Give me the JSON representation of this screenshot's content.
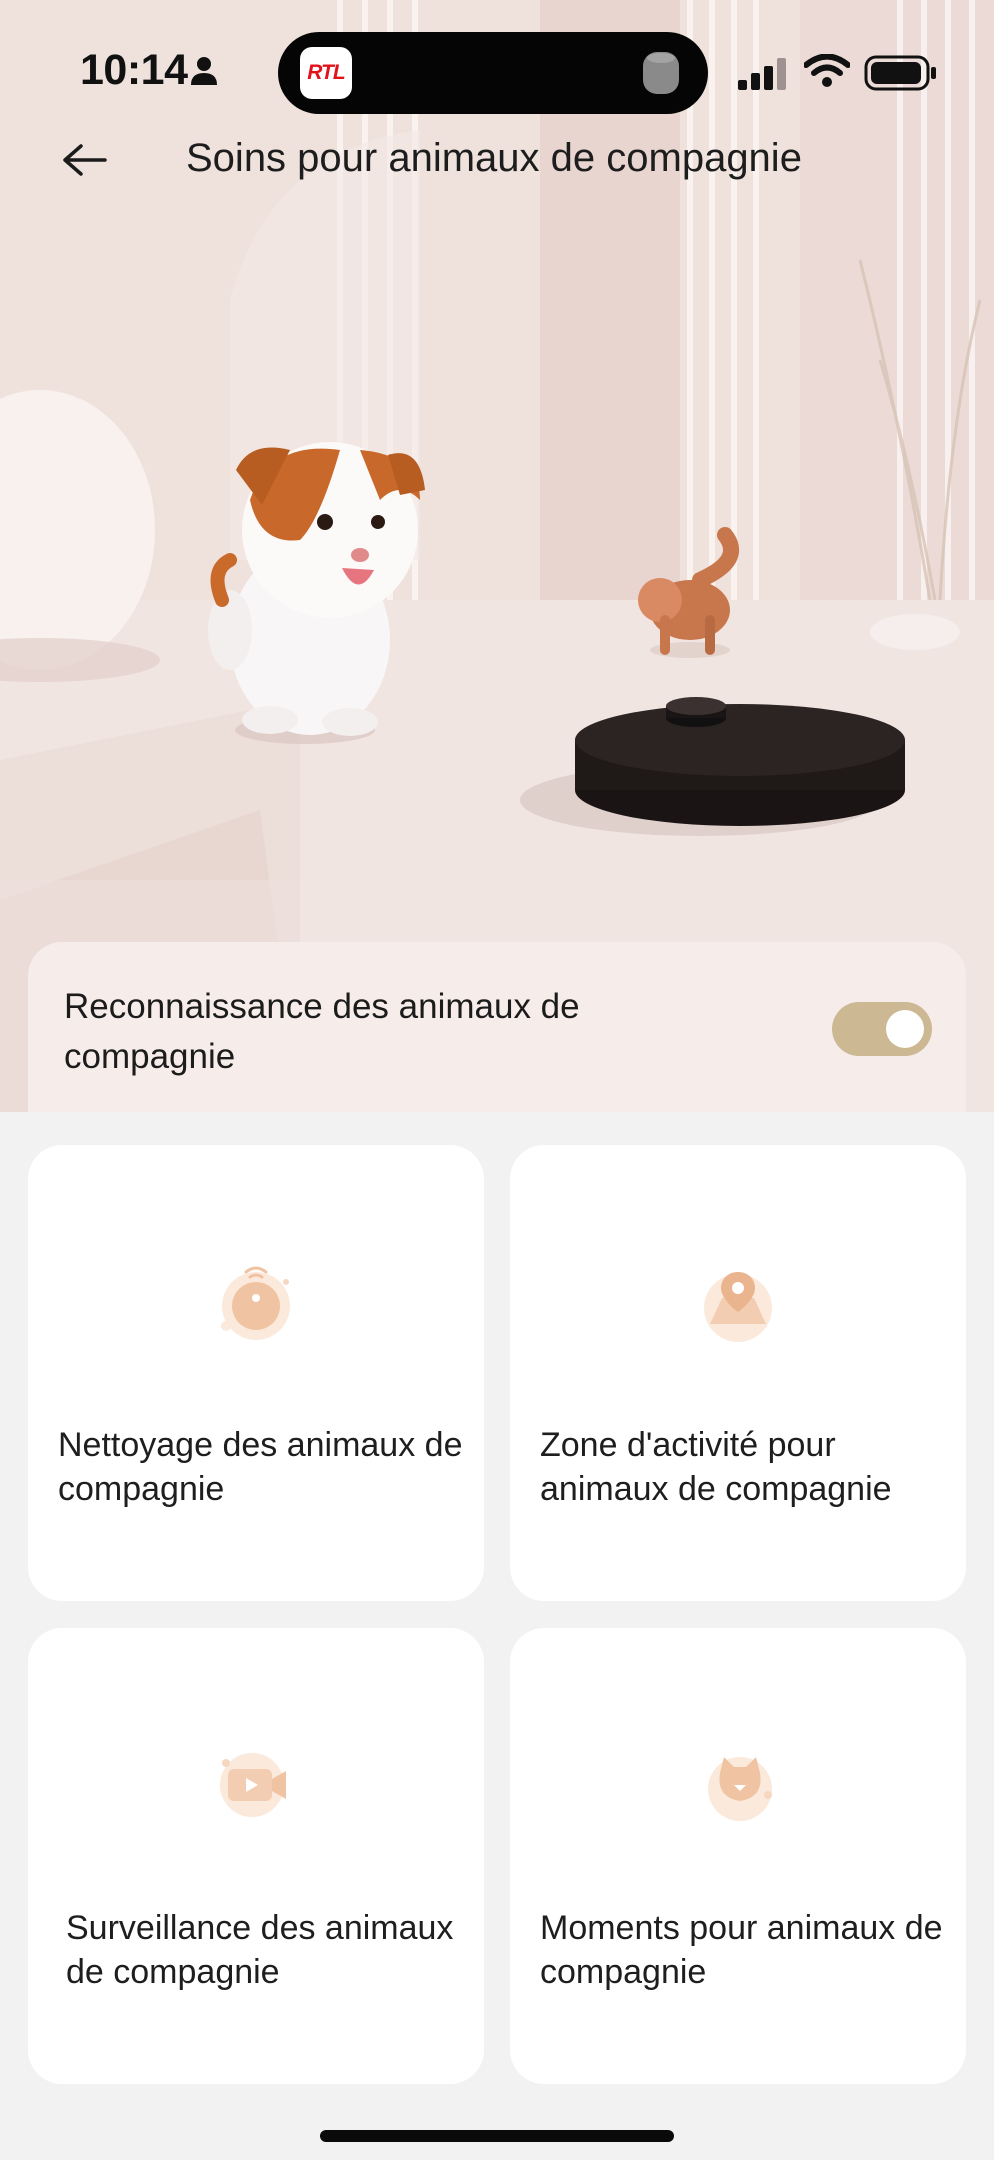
{
  "status_bar": {
    "time": "10:14",
    "live_activity_badge": "RTL",
    "icons": [
      "person-icon",
      "homepod-icon",
      "signal-icon",
      "wifi-icon",
      "battery-icon"
    ]
  },
  "nav": {
    "back_icon": "arrow-left-icon",
    "title": "Soins pour animaux de compagnie"
  },
  "recognition": {
    "label": "Reconnaissance des animaux de compagnie",
    "enabled": true
  },
  "features": [
    {
      "label": "Nettoyage des animaux de compagnie",
      "icon": "robot-cleaner-icon"
    },
    {
      "label": "Zone d'activité pour animaux de compagnie",
      "icon": "map-pin-icon"
    },
    {
      "label": "Surveillance des animaux de compagnie",
      "icon": "video-camera-icon"
    },
    {
      "label": "Moments pour animaux de compagnie",
      "icon": "cat-face-icon"
    }
  ],
  "colors": {
    "accent": "#cdb894",
    "icon_tint": "#f0c3a2",
    "card_bg": "#ffffff",
    "page_bg": "#f3f2f2"
  }
}
